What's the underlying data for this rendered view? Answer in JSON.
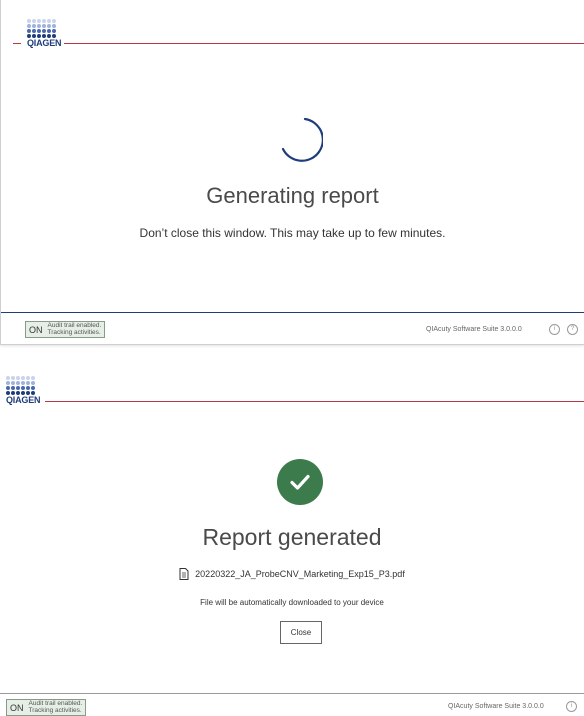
{
  "brand": {
    "logo_text": "QIAGEN",
    "accent": "#b73a4a",
    "logo_blue": "#1f3d7a",
    "logo_light": "#b9c6e4"
  },
  "generating": {
    "title": "Generating report",
    "message": "Don’t close this window. This may take up to few minutes."
  },
  "generated": {
    "title": "Report generated",
    "file_name": "20220322_JA_ProbeCNV_Marketing_Exp15_P3.pdf",
    "file_icon": "document-icon",
    "download_note": "File will be automatically downloaded to your device",
    "close_label": "Close",
    "success_color": "#3c7b4c"
  },
  "footer": {
    "audit_toggle": "ON",
    "audit_line1": "Audit trail enabled.",
    "audit_line2": "Tracking activities.",
    "version": "QIAcuty Software Suite 3.0.0.0",
    "info_icon": "i",
    "help_icon": "?"
  }
}
